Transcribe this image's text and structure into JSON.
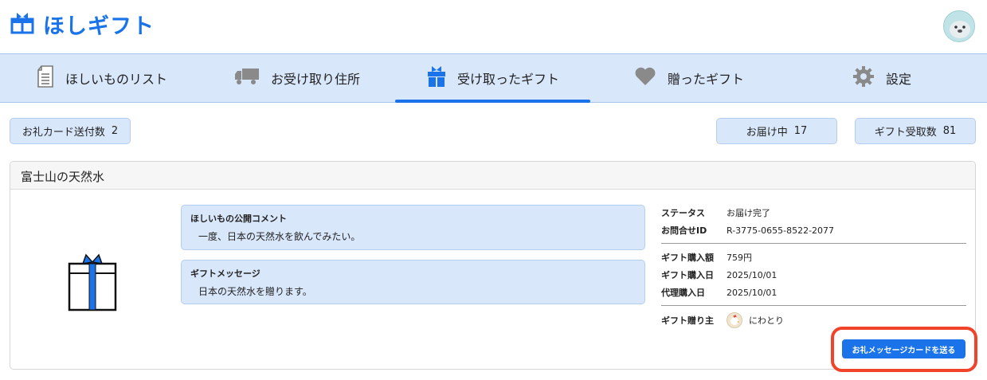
{
  "app": {
    "title": "ほしギフト"
  },
  "nav": {
    "items": [
      {
        "label": "ほしいものリスト",
        "icon": "document-icon"
      },
      {
        "label": "お受け取り住所",
        "icon": "truck-icon"
      },
      {
        "label": "受け取ったギフト",
        "icon": "gift-icon",
        "active": true
      },
      {
        "label": "贈ったギフト",
        "icon": "heart-icon"
      },
      {
        "label": "設定",
        "icon": "gear-icon"
      }
    ]
  },
  "stats": {
    "thanks_card_label": "お礼カード送付数",
    "thanks_card_count": "2",
    "in_delivery_label": "お届け中",
    "in_delivery_count": "17",
    "received_label": "ギフト受取数",
    "received_count": "81"
  },
  "gift": {
    "title": "富士山の天然水",
    "public_comment_title": "ほしいもの公開コメント",
    "public_comment": "一度、日本の天然水を飲んでみたい。",
    "message_title": "ギフトメッセージ",
    "message": "日本の天然水を贈ります。",
    "status_label": "ステータス",
    "status_value": "お届け完了",
    "inquiry_label": "お問合せID",
    "inquiry_value": "R-3775-0655-8522-2077",
    "price_label": "ギフト購入額",
    "price_value": "759円",
    "purchase_date_label": "ギフト購入日",
    "purchase_date_value": "2025/10/01",
    "proxy_date_label": "代理購入日",
    "proxy_date_value": "2025/10/01",
    "sender_label": "ギフト贈り主",
    "sender_value": "にわとり",
    "send_button_label": "お礼メッセージカードを送る"
  },
  "colors": {
    "brand": "#1a73e8",
    "nav_bg": "#d9e7fb",
    "highlight": "#f0432a"
  }
}
